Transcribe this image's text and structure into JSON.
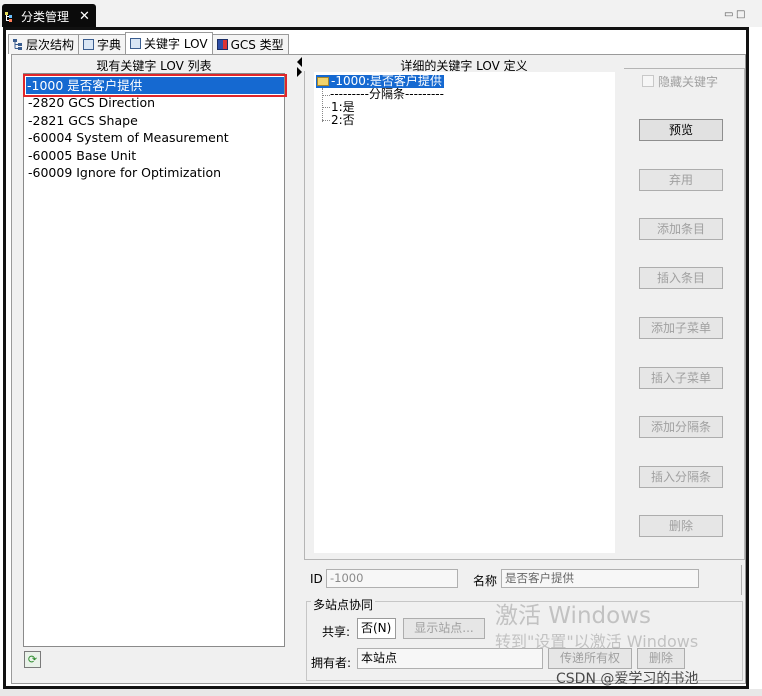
{
  "view_tab": {
    "title": "分类管理",
    "close": "✕"
  },
  "window_controls": {
    "minimize": "▭",
    "maximize": "□"
  },
  "sub_tabs": [
    {
      "label": "层次结构",
      "icon": "hierarchy-icon"
    },
    {
      "label": "字典",
      "icon": "dictionary-icon"
    },
    {
      "label": "关键字 LOV",
      "icon": "keyword-lov-icon",
      "active": true
    },
    {
      "label": "GCS 类型",
      "icon": "gcs-type-icon"
    }
  ],
  "left_panel": {
    "title": "现有关键字 LOV 列表",
    "items": [
      "-1000  是否客户提供",
      "-2820  GCS Direction",
      "-2821  GCS Shape",
      "-60004  System of Measurement",
      "-60005  Base Unit",
      "-60009  Ignore for Optimization"
    ],
    "selected_index": 0
  },
  "right_panel": {
    "title": "详细的关键字 LOV 定义",
    "tree": {
      "root": "-1000:是否客户提供",
      "separator": "---------分隔条---------",
      "children": [
        "1:是",
        "2:否"
      ]
    },
    "hide_keyword_label": "隐藏关键字",
    "buttons": {
      "preview": "预览",
      "deprecate": "弃用",
      "add_item": "添加条目",
      "insert_item": "插入条目",
      "add_submenu": "添加子菜单",
      "insert_submenu": "插入子菜单",
      "add_separator": "添加分隔条",
      "insert_separator": "插入分隔条",
      "delete": "删除"
    },
    "id_label": "ID",
    "id_value": "-1000",
    "name_label": "名称",
    "name_value": "是否客户提供"
  },
  "multi_site": {
    "title": "多站点协同",
    "share_label": "共享:",
    "share_value": "否(N)",
    "show_sites_button": "显示站点...",
    "owner_label": "拥有者:",
    "owner_value": "本站点",
    "transfer_button": "传递所有权",
    "delete_button": "删除"
  },
  "refresh_icon": "refresh-icon",
  "watermark": {
    "line1": "激活 Windows",
    "line2": "转到\"设置\"以激活 Windows",
    "credit": "CSDN @爱学习的书池"
  },
  "colors": {
    "selection": "#1569d1",
    "highlight_box": "#e0262a",
    "panel_bg": "#f0f0f0",
    "disabled_text": "#a0a0a0"
  }
}
